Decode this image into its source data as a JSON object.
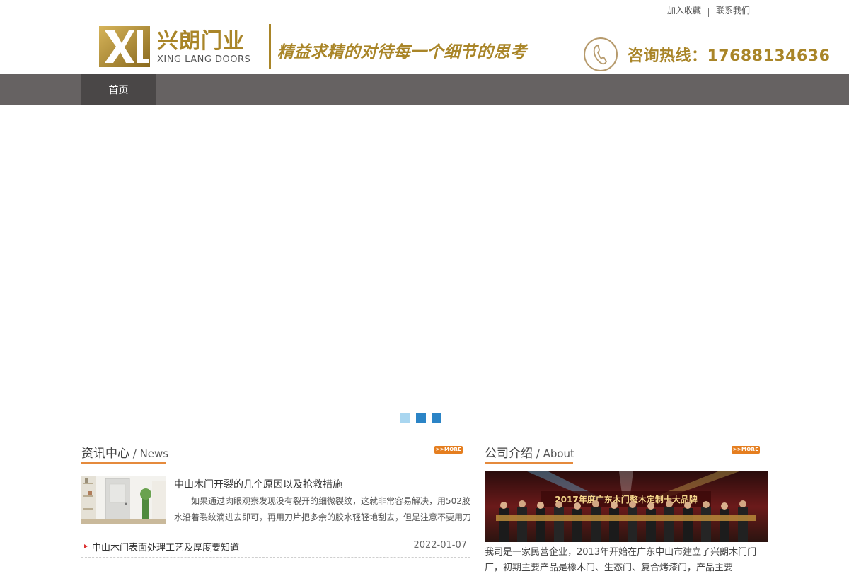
{
  "toplinks": {
    "bookmark": "加入收藏",
    "contact": "联系我们"
  },
  "header": {
    "logo_cn": "兴朗门业",
    "logo_en": "XING LANG DOORS",
    "slogan": "精益求精的对待每一个细节的思考",
    "hotline": "咨询热线：17688134636"
  },
  "nav": {
    "home": "首页"
  },
  "news": {
    "title_cn": "资讯中心",
    "title_en": " / News",
    "more": ">>MORE",
    "featured": {
      "title": "中山木门开裂的几个原因以及抢救措施",
      "excerpt": "如果通过肉眼观察发现没有裂开的细微裂纹，这就非常容易解决，用502胶水沿着裂纹滴进去即可，再用刀片把多余的胶水轻轻地刮去，但是注意不要用刀"
    },
    "rows": [
      {
        "title": "中山木门表面处理工艺及厚度要知道",
        "date": "2022-01-07"
      }
    ]
  },
  "about": {
    "title_cn": "公司介绍",
    "title_en": " / About",
    "more": ">>MORE",
    "image_banner": "2017年度广东木门整木定制十大品牌",
    "text": "我司是一家民营企业，2013年开始在广东中山市建立了兴朗木门门厂，初期主要产品是橡木门、生态门、复合烤漆门，产品主要"
  },
  "colors": {
    "gold": "#a98528",
    "nav": "#666262",
    "nav_active": "#4a4747",
    "accent": "#e58a3c"
  }
}
